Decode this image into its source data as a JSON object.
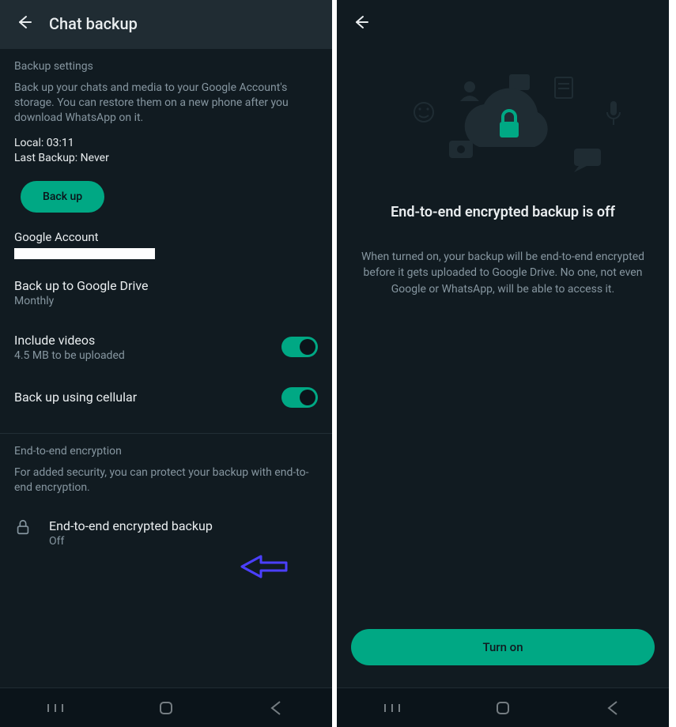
{
  "left": {
    "header_title": "Chat backup",
    "backup_settings_header": "Backup settings",
    "backup_description": "Back up your chats and media to your Google Account's storage. You can restore them on a new phone after you download WhatsApp on it.",
    "local_label": "Local: 03:11",
    "last_backup_label": "Last Backup: Never",
    "backup_button": "Back up",
    "google_account_label": "Google Account",
    "google_account_value_redacted": "",
    "gdrive_label": "Back up to Google Drive",
    "gdrive_value": "Monthly",
    "include_videos_label": "Include videos",
    "include_videos_sub": "4.5 MB to be uploaded",
    "cellular_label": "Back up using cellular",
    "e2e_section_header": "End-to-end encryption",
    "e2e_section_desc": "For added security, you can protect your backup with end-to-end encryption.",
    "e2e_setting_label": "End-to-end encrypted backup",
    "e2e_setting_value": "Off"
  },
  "right": {
    "title": "End-to-end encrypted backup is off",
    "desc": "When turned on, your backup will be end-to-end encrypted before it gets uploaded to Google Drive. No one, not even Google or WhatsApp, will be able to access it.",
    "turn_on_button": "Turn on"
  },
  "colors": {
    "accent": "#00a884",
    "bg": "#111b21",
    "header_bg": "#202c33",
    "muted": "#8696a0",
    "arrow": "#4b3fff"
  }
}
